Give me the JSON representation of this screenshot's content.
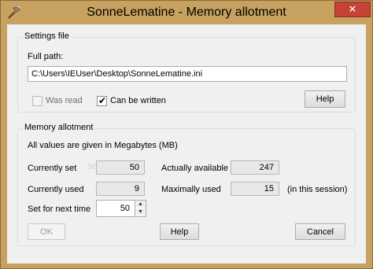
{
  "window": {
    "title": "SonneLematine - Memory allotment",
    "close_symbol": "✕",
    "icon": "hammer-icon"
  },
  "settings_file": {
    "group_title": "Settings file",
    "full_path_label": "Full path:",
    "full_path_value": "C:\\Users\\IEUser\\Desktop\\SonneLematine.ini",
    "was_read_label": "Was read",
    "was_read_checked": false,
    "can_be_written_label": "Can be written",
    "can_be_written_checked": true,
    "checkmark_symbol": "✔",
    "help_label": "Help"
  },
  "memory_allotment": {
    "group_title": "Memory allotment",
    "info_text": "All values are given in Megabytes (MB)",
    "currently_set_label": "Currently set",
    "currently_set_value": "50",
    "actually_available_label": "Actually available",
    "actually_available_value": "247",
    "currently_used_label": "Currently used",
    "currently_used_value": "9",
    "maximally_used_label": "Maximally used",
    "maximally_used_value": "15",
    "in_session_note": "(in this session)",
    "set_next_label": "Set for next time",
    "set_next_value": "50",
    "spin_up": "▲",
    "spin_down": "▼",
    "watermark": "SOFTPEDIA"
  },
  "buttons": {
    "ok": "OK",
    "help": "Help",
    "cancel": "Cancel"
  }
}
